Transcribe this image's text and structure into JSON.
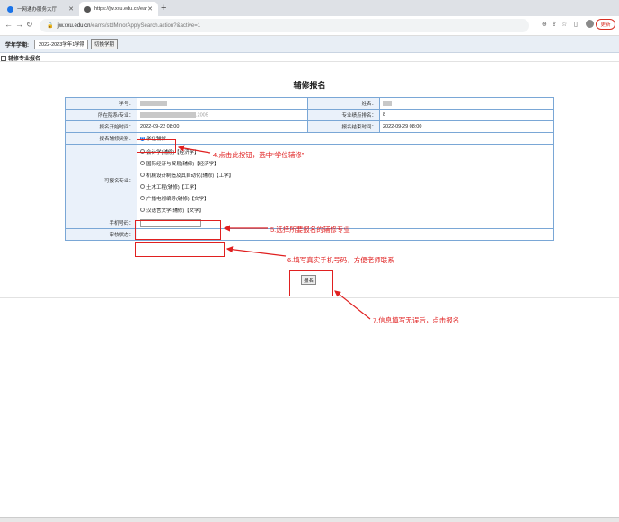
{
  "browser": {
    "tabs": [
      {
        "title": "一网通办服务大厅",
        "favicon_color": "#1a73e8",
        "active": false
      },
      {
        "title": "https://jw.xxu.edu.cn/eams/st",
        "favicon_color": "#555555",
        "active": true
      }
    ],
    "new_tab": "+",
    "url_host": "jw.xxu.edu.cn",
    "url_path": "/eams/stdMinorApplySearch.action?&active=1",
    "update_label": "更新"
  },
  "termbar": {
    "label": "学年学期:",
    "term_value": "2022-2023学年1学期",
    "switch_label": "切换学期"
  },
  "section_title": "辅修专业报名",
  "page_heading": "辅修报名",
  "form": {
    "student_id_label": "学号：",
    "name_label": "姓名：",
    "dept_label": "所在院系/专业：",
    "dept_suffix": ".2005",
    "gpa_rank_label": "专业绩点排名：",
    "gpa_rank_value": "8",
    "start_label": "报名开始时间：",
    "start_value": "2022-09-22 08:00",
    "end_label": "报名结束时间：",
    "end_value": "2022-09-29 08:00",
    "type_label": "报名辅修类别：",
    "type_option": "学位辅修",
    "majors_label": "可报名专业：",
    "majors": [
      "会计学(辅修)【经济学】",
      "国际经济与贸易(辅修)【经济学】",
      "机械设计制造及其自动化(辅修)【工学】",
      "土木工程(辅修)【工学】",
      "广播电视编导(辅修)【文学】",
      "汉语言文学(辅修)【文学】"
    ],
    "phone_label": "手机号码：",
    "review_label": "审核状态："
  },
  "submit_label": "报名",
  "annotations": {
    "step4": "4.点击此按钮，选中“学位辅修”",
    "step5": "5.选择所要报名的辅修专业",
    "step6": "6.填写真实手机号码，方便老师联系",
    "step7": "7.信息填写无误后，点击报名"
  },
  "colors": {
    "annotation": "#e02020",
    "table_border": "#7aa7d6",
    "label_bg": "#eaf1fa"
  }
}
